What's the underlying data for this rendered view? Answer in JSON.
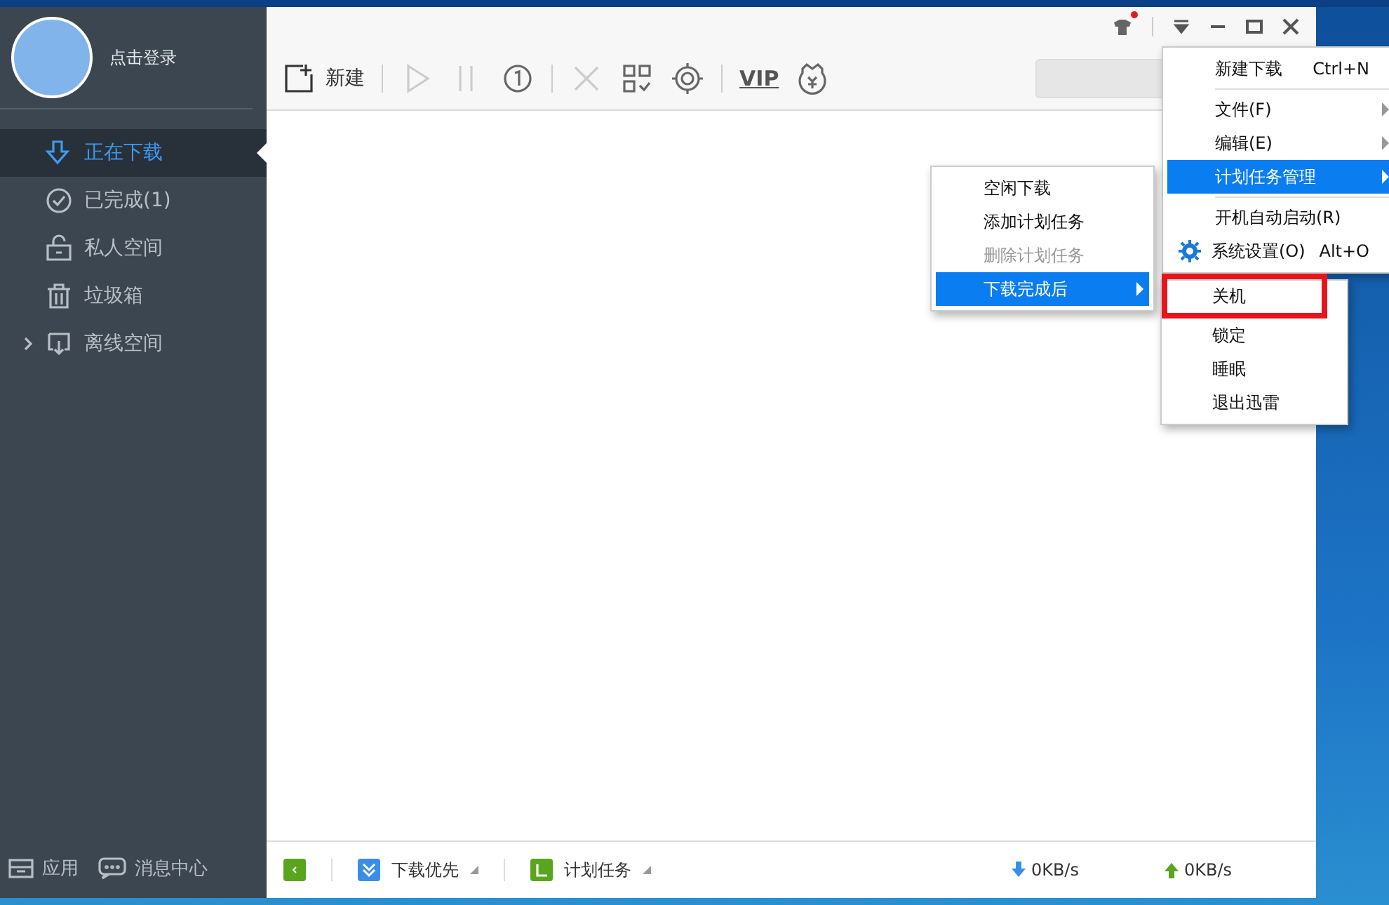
{
  "sidebar": {
    "login": "点击登录",
    "items": [
      {
        "kind": "plain",
        "label": "正在下载",
        "selected": true
      },
      {
        "kind": "plain",
        "label": "已完成(1)",
        "selected": false
      },
      {
        "kind": "plain",
        "label": "私人空间",
        "selected": false
      },
      {
        "kind": "plain",
        "label": "垃圾箱",
        "selected": false
      },
      {
        "kind": "group",
        "label": "离线空间",
        "selected": false,
        "expanded": false
      }
    ],
    "footer": [
      {
        "label": "应用"
      },
      {
        "label": "消息中心"
      }
    ]
  },
  "title_bar": {
    "skin_notification": true
  },
  "toolbar": {
    "new_label": "新建",
    "vip": "VIP",
    "buttons": [
      {
        "disabled": true
      },
      {
        "disabled": true
      },
      {
        "disabled": false
      },
      {
        "disabled": true
      },
      {
        "disabled": false
      },
      {
        "disabled": false
      },
      {
        "disabled": false
      }
    ]
  },
  "main_menu": {
    "items": [
      {
        "kind": "item",
        "label": "新建下载",
        "shortcut": "Ctrl+N",
        "submenu": false,
        "selected": false
      },
      {
        "kind": "separator"
      },
      {
        "kind": "item",
        "label": "文件(F)",
        "submenu": true,
        "selected": false
      },
      {
        "kind": "item",
        "label": "编辑(E)",
        "submenu": true,
        "selected": false
      },
      {
        "kind": "item",
        "label": "计划任务管理",
        "submenu": true,
        "selected": true
      },
      {
        "kind": "separator"
      },
      {
        "kind": "item",
        "label": "开机自动启动(R)",
        "submenu": false,
        "selected": false
      },
      {
        "kind": "iconitem",
        "label": "系统设置(O)",
        "shortcut": "Alt+O",
        "submenu": false,
        "selected": false
      }
    ]
  },
  "schedule_menu": {
    "items": [
      {
        "label": "空闲下载",
        "disabled": false,
        "submenu": false,
        "selected": false
      },
      {
        "label": "添加计划任务",
        "disabled": false,
        "submenu": false,
        "selected": false
      },
      {
        "label": "删除计划任务",
        "disabled": true,
        "submenu": false,
        "selected": false
      },
      {
        "label": "下载完成后",
        "disabled": false,
        "submenu": true,
        "selected": true
      }
    ]
  },
  "after_menu": {
    "items": [
      {
        "label": "关机",
        "highlighted": true
      },
      {
        "label": "锁定",
        "highlighted": false
      },
      {
        "label": "睡眠",
        "highlighted": false
      },
      {
        "label": "退出迅雷",
        "highlighted": false
      }
    ]
  },
  "status_bar": {
    "priority": "下载优先",
    "schedule": "计划任务",
    "download_speed": "0KB/s",
    "upload_speed": "0KB/s"
  }
}
